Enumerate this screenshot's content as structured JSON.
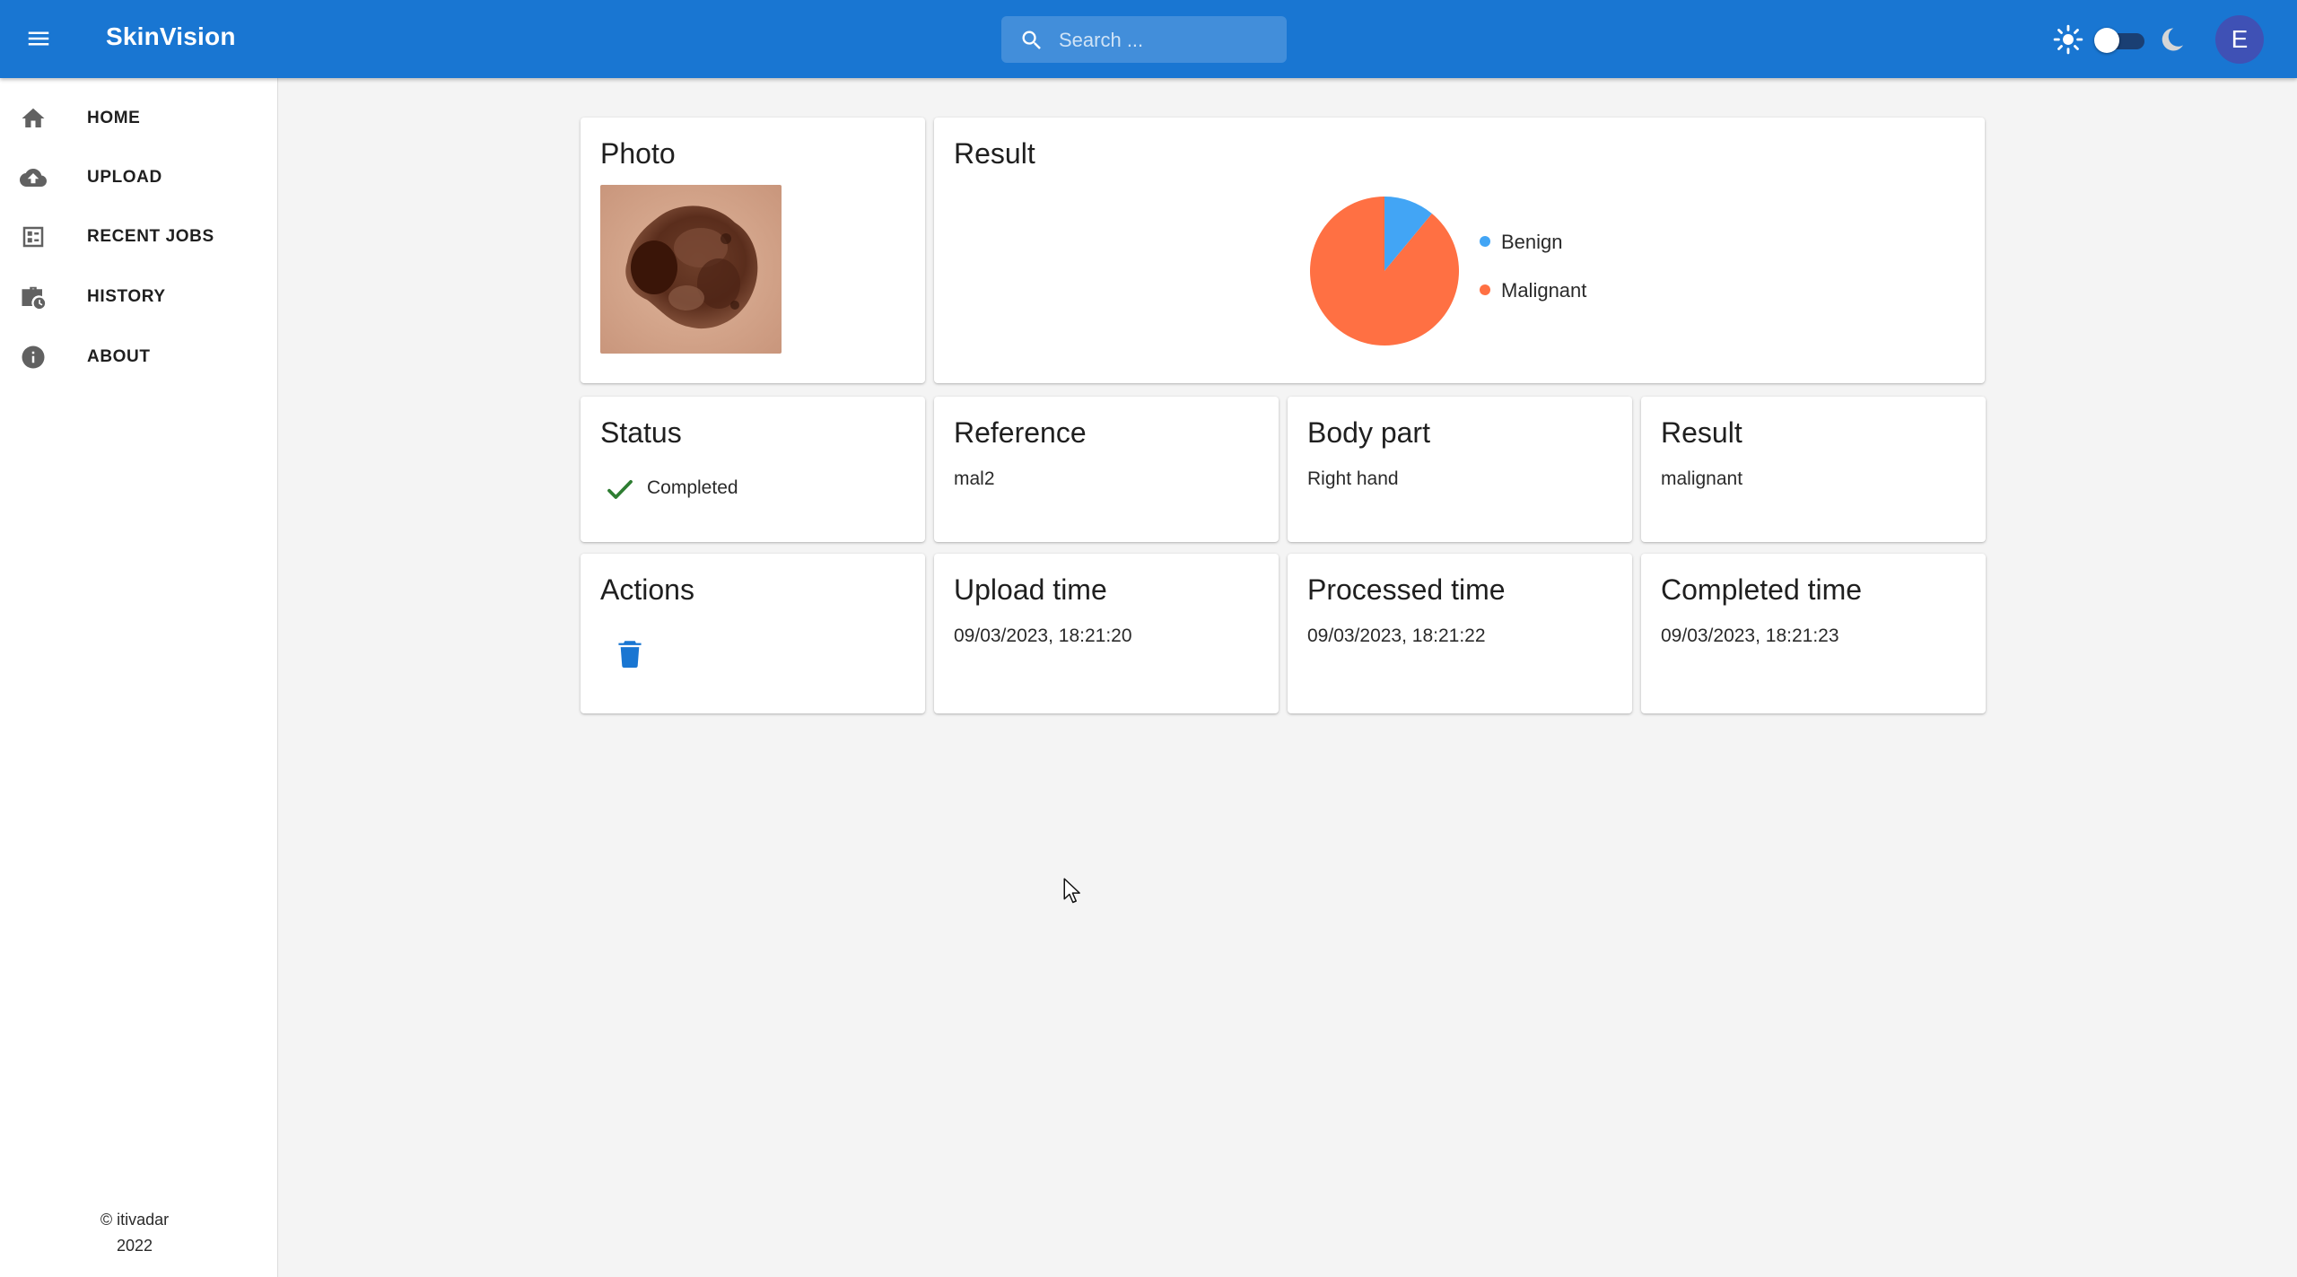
{
  "app": {
    "title": "SkinVision",
    "search_placeholder": "Search ...",
    "avatar_initial": "E",
    "accent_color": "#1976d2"
  },
  "sidebar": {
    "items": [
      {
        "label": "HOME",
        "icon": "home-icon"
      },
      {
        "label": "UPLOAD",
        "icon": "cloud-upload-icon"
      },
      {
        "label": "RECENT JOBS",
        "icon": "list-alt-icon"
      },
      {
        "label": "HISTORY",
        "icon": "work-history-icon"
      },
      {
        "label": "ABOUT",
        "icon": "info-icon"
      }
    ],
    "copyright_line1": "© itivadar",
    "copyright_line2": "2022"
  },
  "cards": {
    "photo": {
      "title": "Photo"
    },
    "result_chart": {
      "title": "Result"
    },
    "status": {
      "title": "Status",
      "value": "Completed",
      "icon": "check-icon",
      "color": "#2e7d32"
    },
    "reference": {
      "title": "Reference",
      "value": "mal2"
    },
    "body_part": {
      "title": "Body part",
      "value": "Right hand"
    },
    "result": {
      "title": "Result",
      "value": "malignant"
    },
    "actions": {
      "title": "Actions",
      "icon": "trash-icon"
    },
    "upload_time": {
      "title": "Upload time",
      "value": "09/03/2023, 18:21:20"
    },
    "processed_time": {
      "title": "Processed time",
      "value": "09/03/2023, 18:21:22"
    },
    "completed_time": {
      "title": "Completed time",
      "value": "09/03/2023, 18:21:23"
    }
  },
  "chart_data": {
    "type": "pie",
    "categories": [
      "Benign",
      "Malignant"
    ],
    "values": [
      11,
      89
    ],
    "colors": [
      "#42a5f5",
      "#ff7043"
    ],
    "legend": "right"
  }
}
